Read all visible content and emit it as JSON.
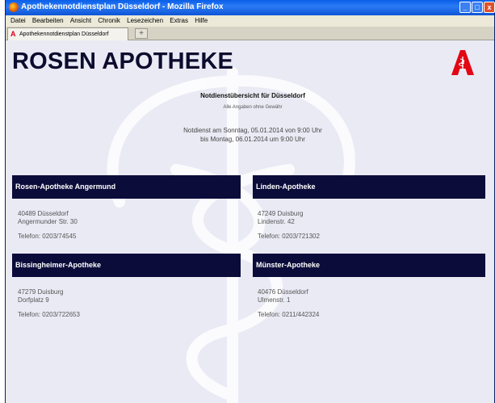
{
  "window": {
    "title": "Apothekennotdienstplan Düsseldorf - Mozilla Firefox",
    "controls": {
      "minimize": "_",
      "maximize": "□",
      "close": "x"
    }
  },
  "menu": [
    "Datei",
    "Bearbeiten",
    "Ansicht",
    "Chronik",
    "Lesezeichen",
    "Extras",
    "Hilfe"
  ],
  "tab": {
    "label": "Apothekennotdienstplan Düsseldorf",
    "new_tab": "+"
  },
  "page": {
    "brand": "ROSEN APOTHEKE",
    "title": "Notdienstübersicht für Düsseldorf",
    "subtitle": "Alle Angaben ohne Gewähr",
    "duty_line1": "Notdienst am Sonntag, 05.01.2014 von 9:00 Uhr",
    "duty_line2": "bis Montag, 06.01.2014 um 9:00 Uhr",
    "colors": {
      "header_bg": "#0c0c3a",
      "page_bg": "#eaeaf5",
      "logo_red": "#e30613"
    }
  },
  "pharmacies": [
    {
      "name": "Rosen-Apotheke Angermund",
      "city": "40489  Düsseldorf",
      "street": "Angermunder Str. 30",
      "phone": "Telefon: 0203/74545"
    },
    {
      "name": "Linden-Apotheke",
      "city": "47249  Duisburg",
      "street": "Lindenstr. 42",
      "phone": "Telefon: 0203/721302"
    },
    {
      "name": "Bissingheimer-Apotheke",
      "city": "47279  Duisburg",
      "street": "Dorfplatz 9",
      "phone": "Telefon: 0203/722653"
    },
    {
      "name": "Münster-Apotheke",
      "city": "40476  Düsseldorf",
      "street": "Ulmenstr. 1",
      "phone": "Telefon: 0211/442324"
    }
  ]
}
